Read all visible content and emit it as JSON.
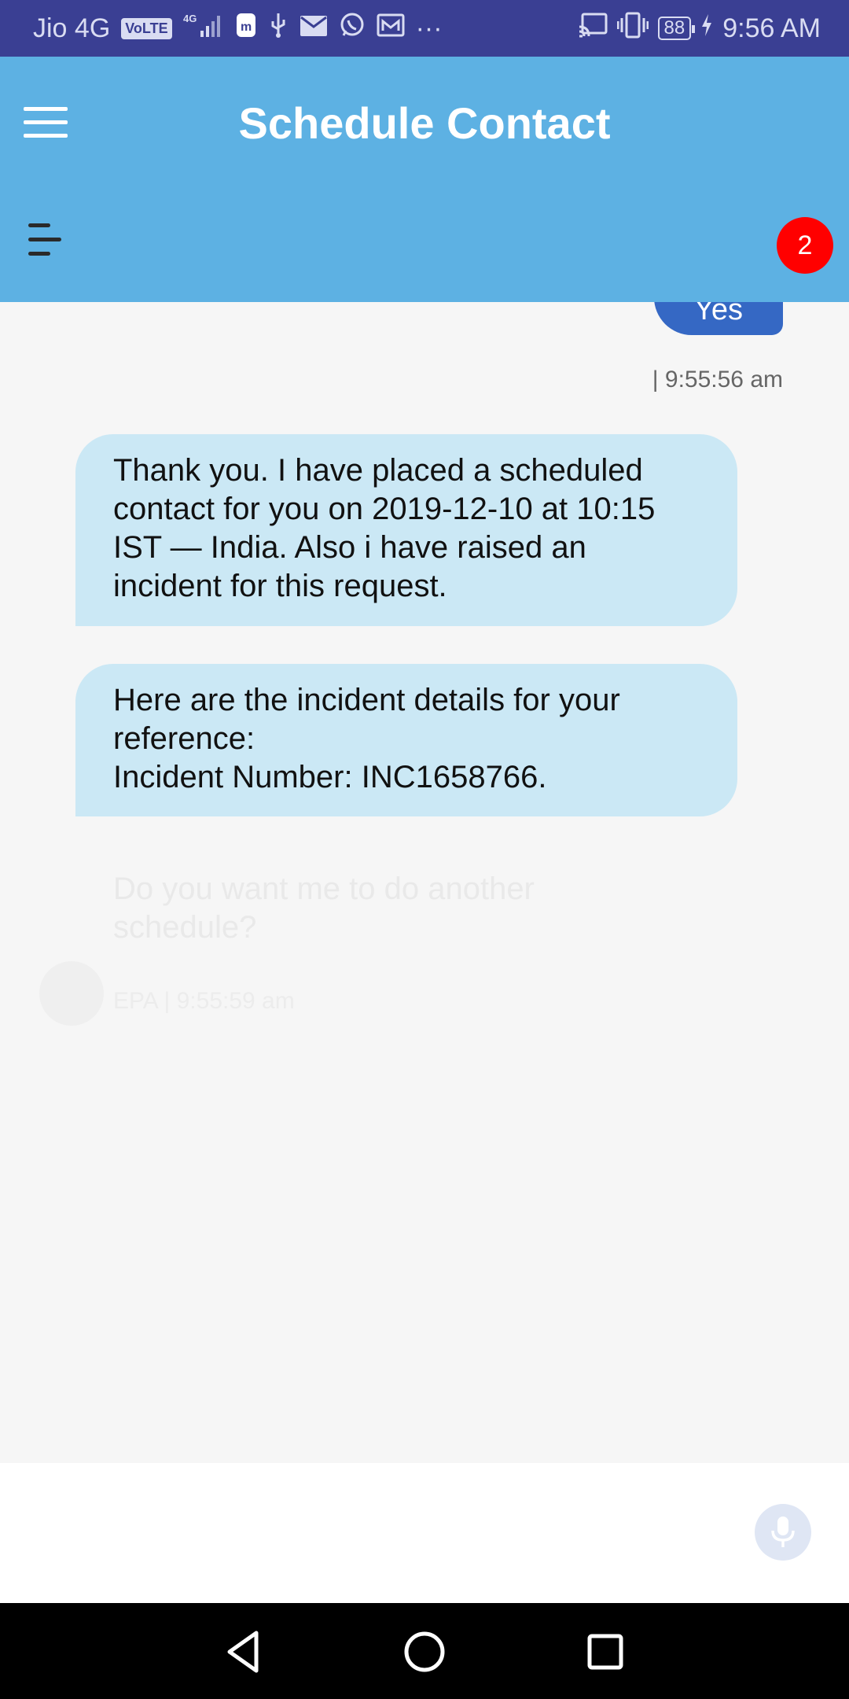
{
  "status_bar": {
    "carrier": "Jio 4G",
    "volte": "VoLTE",
    "network_type": "4G",
    "more": "···",
    "battery": "88",
    "time": "9:56 AM",
    "icons": [
      "signal-icon",
      "app-icon",
      "usb-icon",
      "mail-icon",
      "whatsapp-icon",
      "mail-alt-icon",
      "cast-icon",
      "vibrate-icon",
      "charging-icon"
    ]
  },
  "header": {
    "title": "Schedule Contact",
    "badge_count": "2"
  },
  "chat": {
    "user_message": {
      "text": "Yes",
      "time": "| 9:55:56 am"
    },
    "bot_messages": [
      {
        "line1": "Thank you. I have placed a scheduled",
        "line2": "contact for you on 2019-12-10 at 10:15",
        "line3": "IST — India. Also i have raised an",
        "line4": "incident for this request."
      },
      {
        "line1": "Here are the incident details for your",
        "line2": "reference:",
        "line3": "Incident Number: INC1658766."
      }
    ],
    "pending_message": {
      "line1": "Do you want me to do another",
      "line2": "schedule?",
      "meta": "EPA | 9:55:59 am"
    }
  },
  "colors": {
    "status_bar": "#3a3f93",
    "header": "#5db1e3",
    "user_bubble": "#3568c4",
    "bot_bubble": "#cbe8f5",
    "badge": "#ff0000",
    "background": "#f6f6f6"
  }
}
